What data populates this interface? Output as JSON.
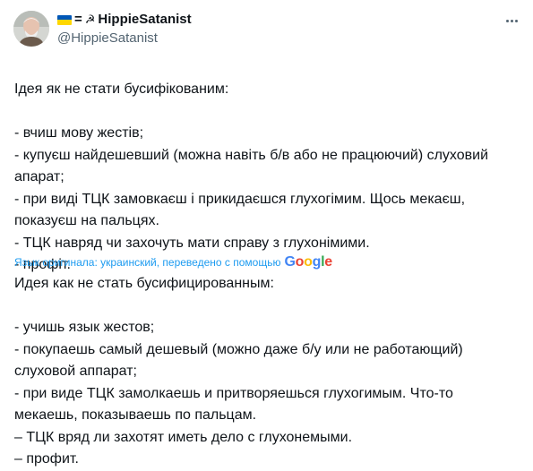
{
  "author": {
    "prefix_emoji": "🇺🇦",
    "prefix_symbols": "=",
    "prefix_hammer": "☭",
    "display_name": "HippieSatanist",
    "handle": "@HippieSatanist"
  },
  "tweet": {
    "original_lines": [
      "Ідея як не стати бусифікованим:",
      "",
      "- вчиш мову жестів;",
      "- купуєш найдешевший (можна навіть б/в або не працюючий) слуховий",
      "апарат;",
      "- при виді ТЦК замовкаєш і прикидаєшся глухогімим. Щось мекаєш,",
      "показуєш на пальцях.",
      "- ТЦК навряд чи захочуть мати справу з глухонімими.",
      "- профіт."
    ],
    "translation_note": "Язык оригинала: украинский, переведено с помощью",
    "translation_provider": "Google",
    "translated_lines": [
      "Идея как не стать бусифицированным:",
      "",
      "- учишь язык жестов;",
      "- покупаешь самый дешевый (можно даже б/у или не работающий)",
      "слуховой аппарат;",
      "- при виде ТЦК замолкаешь и притворяешься глухогимым. Что-то",
      "мекаешь, показываешь по пальцам.",
      "– ТЦК вряд ли захотят иметь дело с глухонемыми.",
      "– профит."
    ]
  },
  "colors": {
    "text": "#0f1419",
    "secondary": "#536471",
    "link": "#1d9bf0",
    "flag_blue": "#0057b7",
    "flag_yellow": "#ffd700"
  },
  "icons": {
    "more": "more-horizontal-icon",
    "avatar": "avatar-photo"
  }
}
